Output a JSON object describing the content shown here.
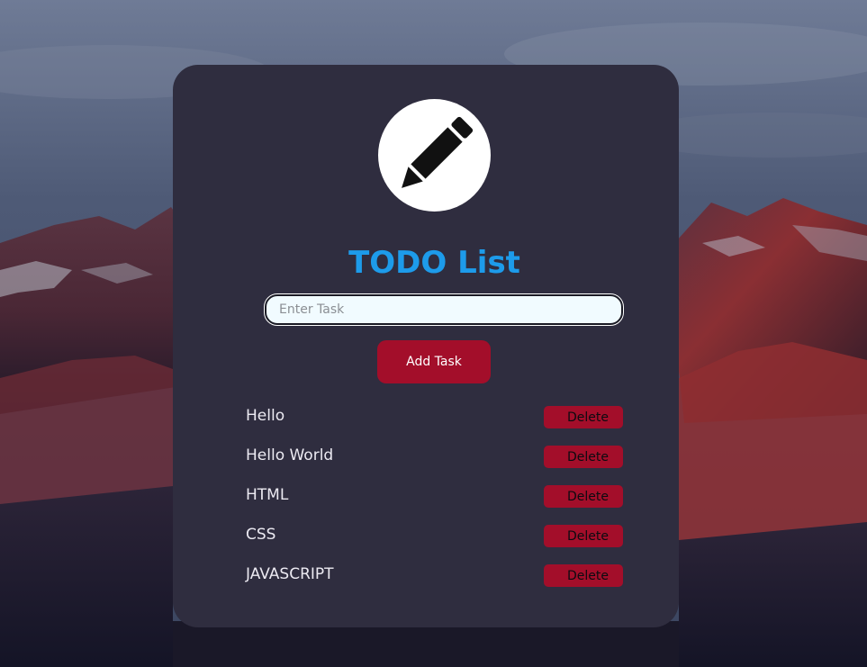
{
  "header": {
    "logo_icon": "pencil-icon",
    "title": "TODO List"
  },
  "form": {
    "input_value": "",
    "input_placeholder": "Enter Task",
    "add_button_label": "Add Task"
  },
  "tasks": [
    {
      "text": "Hello",
      "delete_label": "Delete"
    },
    {
      "text": "Hello World",
      "delete_label": "Delete"
    },
    {
      "text": "HTML",
      "delete_label": "Delete"
    },
    {
      "text": "CSS",
      "delete_label": "Delete"
    },
    {
      "text": "JAVASCRIPT",
      "delete_label": "Delete"
    }
  ],
  "colors": {
    "card_background": "#2f2d3f",
    "title": "#1d9bea",
    "button": "#a30e2a",
    "input_background": "#f1fbff",
    "task_text": "#eceaf2"
  }
}
